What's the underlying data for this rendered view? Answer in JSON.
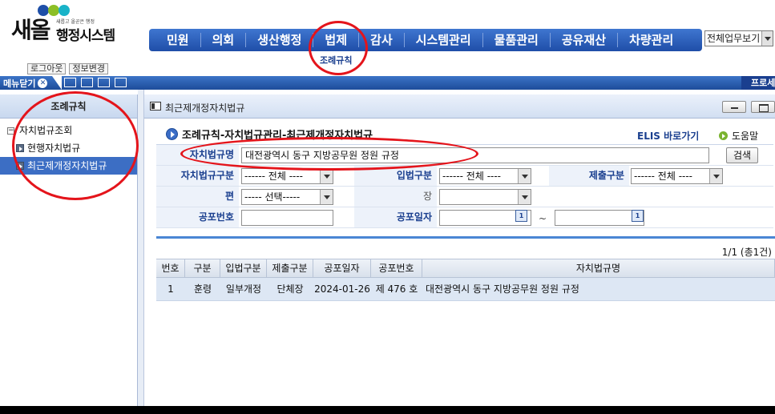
{
  "logo": {
    "main": "새올",
    "slogan": "새롭고 올곧은 행정",
    "sub": "행정시스템"
  },
  "topnav": {
    "items": [
      "민원",
      "의회",
      "생산행정",
      "법제",
      "감사",
      "시스템관리",
      "물품관리",
      "공유재산",
      "차량관리"
    ],
    "active_sub": "조례규칙",
    "work_select": "전체업무보기"
  },
  "account": {
    "logout": "로그아웃",
    "change_info": "정보변경"
  },
  "strip": {
    "menu_close": "메뉴닫기",
    "right_tab": "프로세"
  },
  "sidebar": {
    "title": "조례규칙",
    "group": "자치법규조회",
    "items": [
      "현행자치법규",
      "최근제개정자치법규"
    ],
    "active_index": 1
  },
  "window": {
    "title": "최근제개정자치법규",
    "heading": "조례규칙-자치법규관리-최근제개정자치법규",
    "elis": "ELIS 바로가기",
    "help": "도움말"
  },
  "form": {
    "name_label": "자치법규명",
    "name_value": "대전광역시 동구 지방공무원 정원 규정",
    "search": "검색",
    "type_label": "자치법규구분",
    "type_value": "------ 전체 ----",
    "legislation_label": "입법구분",
    "legislation_value": "------ 전체 ----",
    "submit_label": "제출구분",
    "submit_value": "------ 전체 ----",
    "volume_label": "편",
    "volume_value": "----- 선택-----",
    "chapter_label": "장",
    "chapter_value": "",
    "promul_no_label": "공포번호",
    "promul_no_value": "",
    "promul_date_label": "공포일자",
    "promul_date_from": "",
    "promul_date_to": "",
    "tilde": "~"
  },
  "results": {
    "count": "1/1 (총1건)",
    "columns": [
      "번호",
      "구분",
      "입법구분",
      "제출구분",
      "공포일자",
      "공포번호",
      "자치법규명"
    ],
    "rows": [
      [
        "1",
        "훈령",
        "일부개정",
        "단체장",
        "2024-01-26",
        "제 476 호",
        "대전광역시 동구 지방공무원 정원 규정"
      ]
    ]
  },
  "colors": {
    "nav_blue": "#1f4ea8",
    "label_blue": "#1a3f8f",
    "row_highlight": "#dde7f4",
    "annotation_red": "#e4141b"
  }
}
